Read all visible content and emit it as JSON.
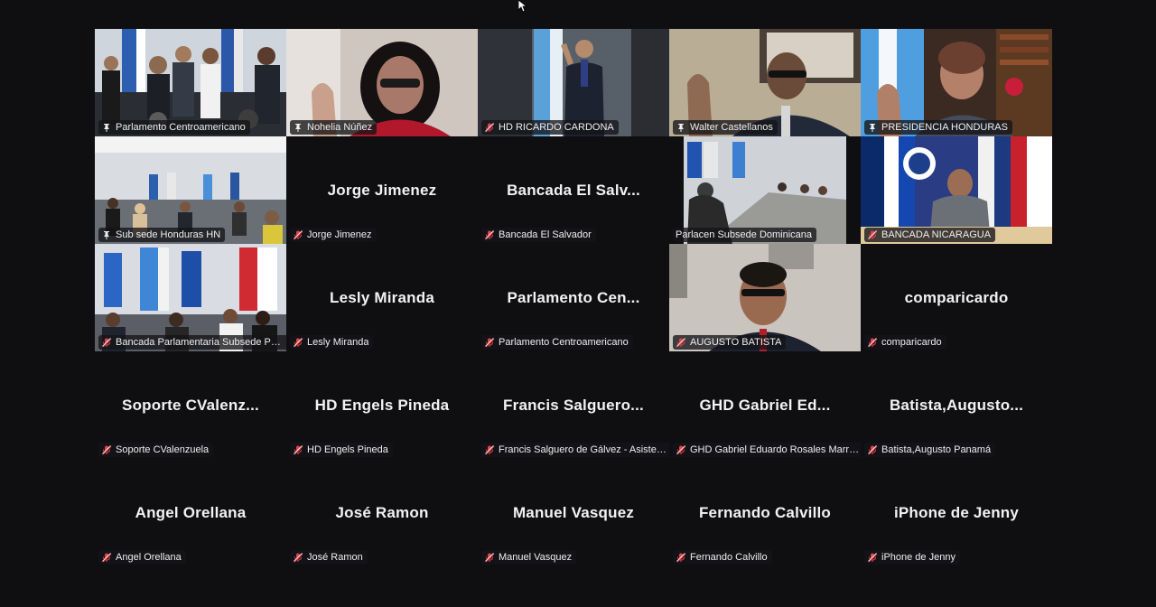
{
  "meeting": {
    "tiles": [
      {
        "name": "Parlamento Centroamericano",
        "display": "",
        "video": "scene-room-flags",
        "mic": "muted-pinned",
        "active": true
      },
      {
        "name": "Nohelia Núñez",
        "display": "",
        "video": "scene-woman-red",
        "mic": "muted-pinned"
      },
      {
        "name": "HD RICARDO CARDONA",
        "display": "",
        "video": "scene-man-flag",
        "mic": "muted-red"
      },
      {
        "name": "Walter Castellanos",
        "display": "",
        "video": "scene-man-wall",
        "mic": "muted-pinned"
      },
      {
        "name": "PRESIDENCIA HONDURAS",
        "display": "",
        "video": "scene-woman-flag",
        "mic": "muted-pinned"
      },
      {
        "name": "Sub sede Honduras HN",
        "display": "",
        "video": "scene-conference",
        "mic": "muted-pinned"
      },
      {
        "name": "Jorge Jimenez",
        "display": "Jorge Jimenez",
        "video": "none",
        "mic": "muted-red"
      },
      {
        "name": "Bancada El Salvador",
        "display": "Bancada El Salv...",
        "video": "none",
        "mic": "muted-red"
      },
      {
        "name": "Parlacen Subsede Dominicana",
        "display": "",
        "video": "scene-table-room",
        "mic": "none"
      },
      {
        "name": "BANCADA NICARAGUA",
        "display": "",
        "video": "scene-nic-flags",
        "mic": "muted-red"
      },
      {
        "name": "Bancada Parlamentaria Subsede Pana...",
        "display": "",
        "video": "scene-panama-flags",
        "mic": "muted-red"
      },
      {
        "name": "Lesly Miranda",
        "display": "Lesly Miranda",
        "video": "none",
        "mic": "muted-red"
      },
      {
        "name": "Parlamento Centroamericano",
        "display": "Parlamento  Cen...",
        "video": "none",
        "mic": "muted-red"
      },
      {
        "name": "AUGUSTO BATISTA",
        "display": "",
        "video": "scene-man-glasses",
        "mic": "muted-red"
      },
      {
        "name": "comparicardo",
        "display": "comparicardo",
        "video": "none",
        "mic": "muted-red"
      },
      {
        "name": "Soporte CValenzuela",
        "display": "Soporte  CValenz...",
        "video": "none",
        "mic": "muted-red"
      },
      {
        "name": "HD Engels Pineda",
        "display": "HD Engels Pineda",
        "video": "none",
        "mic": "muted-red"
      },
      {
        "name": "Francis Salguero de Gálvez - Asistent...",
        "display": "Francis  Salguero...",
        "video": "none",
        "mic": "muted-red"
      },
      {
        "name": "GHD Gabriel Eduardo Rosales Marro...",
        "display": "GHD  Gabriel  Ed...",
        "video": "none",
        "mic": "muted-red"
      },
      {
        "name": "Batista,Augusto Panamá",
        "display": "Batista,Augusto...",
        "video": "none",
        "mic": "muted-red"
      },
      {
        "name": "Angel Orellana",
        "display": "Angel Orellana",
        "video": "none",
        "mic": "muted-red"
      },
      {
        "name": "José Ramon",
        "display": "José Ramon",
        "video": "none",
        "mic": "muted-red"
      },
      {
        "name": "Manuel Vasquez",
        "display": "Manuel Vasquez",
        "video": "none",
        "mic": "muted-red"
      },
      {
        "name": "Fernando Calvillo",
        "display": "Fernando Calvillo",
        "video": "none",
        "mic": "muted-red"
      },
      {
        "name": "iPhone de Jenny",
        "display": "iPhone de Jenny",
        "video": "none",
        "mic": "muted-red"
      }
    ]
  },
  "colors": {
    "background": "#0f0f12",
    "active_border": "#23d959",
    "muted_icon": "#e0424a",
    "label_bg": "#141418"
  }
}
